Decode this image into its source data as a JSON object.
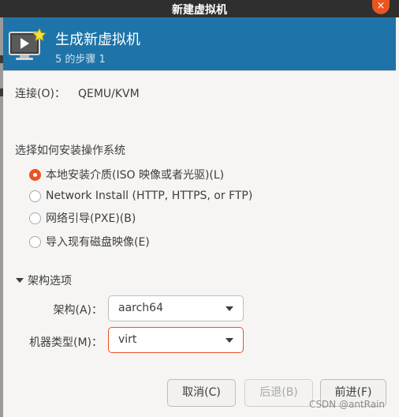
{
  "window": {
    "title": "新建虚拟机",
    "close_glyph": "×"
  },
  "header": {
    "title": "生成新虚拟机",
    "step": "5 的步骤 1",
    "icon": "monitor-with-star-icon"
  },
  "connection": {
    "label": "连接(O)：",
    "value": "QEMU/KVM"
  },
  "install": {
    "heading": "选择如何安装操作系统",
    "options": [
      {
        "label": "本地安装介质(ISO 映像或者光驱)(L)",
        "checked": true
      },
      {
        "label": "Network Install (HTTP, HTTPS, or FTP)",
        "checked": false
      },
      {
        "label": "网络引导(PXE)(B)",
        "checked": false
      },
      {
        "label": "导入现有磁盘映像(E)",
        "checked": false
      }
    ]
  },
  "arch": {
    "expander_label": "架构选项",
    "arch_label": "架构(A)：",
    "arch_value": "aarch64",
    "machine_label": "机器类型(M)：",
    "machine_value": "virt"
  },
  "buttons": {
    "cancel": "取消(C)",
    "back": "后退(B)",
    "forward": "前进(F)"
  },
  "watermark": "CSDN @antRain",
  "colors": {
    "header_bg": "#1e74a8",
    "accent": "#e95420",
    "titlebar_bg": "#2f2f2f"
  }
}
